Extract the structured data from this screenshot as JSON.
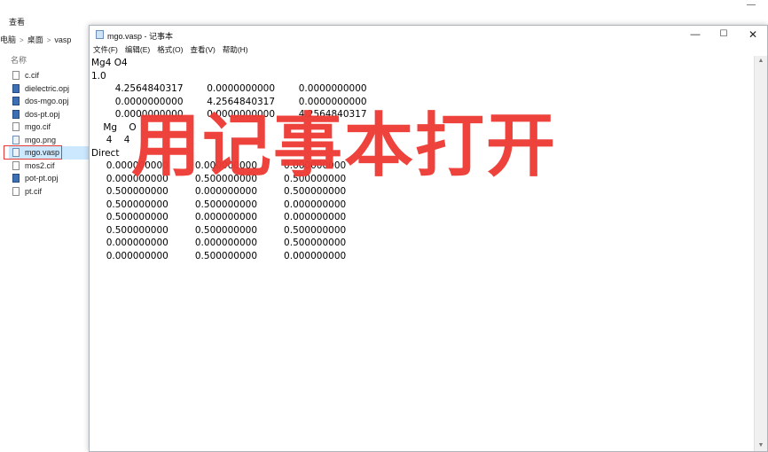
{
  "explorer": {
    "menu_label": "查看",
    "minimize_glyph": "—",
    "breadcrumb": [
      "电脑",
      "桌面",
      "vasp"
    ],
    "breadcrumb_sep": ">",
    "column_header": "名称",
    "files": [
      {
        "name": "c.cif",
        "type": "cif"
      },
      {
        "name": "dielectric.opj",
        "type": "opj"
      },
      {
        "name": "dos-mgo.opj",
        "type": "opj"
      },
      {
        "name": "dos-pt.opj",
        "type": "opj"
      },
      {
        "name": "mgo.cif",
        "type": "cif"
      },
      {
        "name": "mgo.png",
        "type": "png"
      },
      {
        "name": "mgo.vasp",
        "type": "vasp",
        "selected": true
      },
      {
        "name": "mos2.cif",
        "type": "cif"
      },
      {
        "name": "pot-pt.opj",
        "type": "opj"
      },
      {
        "name": "pt.cif",
        "type": "cif"
      }
    ]
  },
  "notepad": {
    "title": "mgo.vasp - 记事本",
    "controls": {
      "minimize": "—",
      "maximize": "☐",
      "close": "✕"
    },
    "menu": [
      "文件(F)",
      "编辑(E)",
      "格式(O)",
      "查看(V)",
      "帮助(H)"
    ],
    "scroll_up": "▲",
    "scroll_down": "▼",
    "content": "Mg4 O4\n1.0\n        4.2564840317        0.0000000000        0.0000000000\n        0.0000000000        4.2564840317        0.0000000000\n        0.0000000000        0.0000000000        4.2564840317\n    Mg    O\n     4    4\nDirect\n     0.000000000         0.000000000         0.000000000\n     0.000000000         0.500000000         0.500000000\n     0.500000000         0.000000000         0.500000000\n     0.500000000         0.500000000         0.000000000\n     0.500000000         0.000000000         0.000000000\n     0.500000000         0.500000000         0.500000000\n     0.000000000         0.000000000         0.500000000\n     0.000000000         0.500000000         0.000000000"
  },
  "annotation": {
    "text": "用记事本打开",
    "color": "#ee3b35"
  }
}
